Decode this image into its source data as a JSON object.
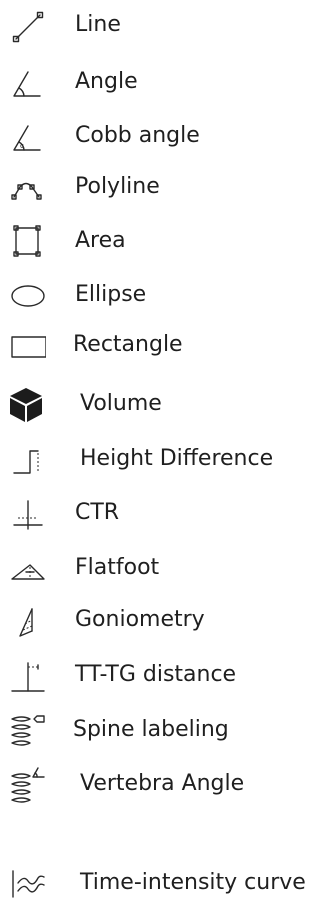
{
  "menu": {
    "items": [
      {
        "label": "Line",
        "icon": "line-icon"
      },
      {
        "label": "Angle",
        "icon": "angle-icon"
      },
      {
        "label": "Cobb angle",
        "icon": "cobb-angle-icon"
      },
      {
        "label": "Polyline",
        "icon": "polyline-icon"
      },
      {
        "label": "Area",
        "icon": "area-icon"
      },
      {
        "label": "Ellipse",
        "icon": "ellipse-icon"
      },
      {
        "label": "Rectangle",
        "icon": "rectangle-icon"
      },
      {
        "label": "Volume",
        "icon": "volume-icon"
      },
      {
        "label": "Height Difference",
        "icon": "height-difference-icon"
      },
      {
        "label": "CTR",
        "icon": "ctr-icon"
      },
      {
        "label": "Flatfoot",
        "icon": "flatfoot-icon"
      },
      {
        "label": "Goniometry",
        "icon": "goniometry-icon"
      },
      {
        "label": "TT-TG distance",
        "icon": "tt-tg-distance-icon"
      },
      {
        "label": "Spine labeling",
        "icon": "spine-labeling-icon"
      },
      {
        "label": "Vertebra Angle",
        "icon": "vertebra-angle-icon"
      },
      {
        "label": "Time-intensity curve",
        "icon": "time-intensity-curve-icon"
      }
    ]
  }
}
